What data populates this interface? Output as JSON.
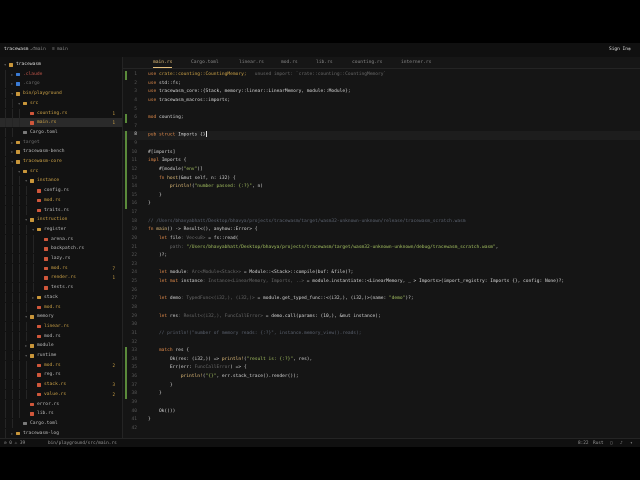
{
  "titlebar": {
    "project": "tracewasm",
    "branch": "main",
    "menu": "main",
    "signin": "Sign In",
    "ellipsis": "..."
  },
  "sidebar": {
    "items": [
      {
        "label": "tracewasm",
        "type": "dir",
        "depth": 0,
        "open": true,
        "color": "#e0e0e0"
      },
      {
        "label": ".claude",
        "type": "dir",
        "depth": 1,
        "open": false,
        "color": "#c4564a"
      },
      {
        "label": ".cargo",
        "type": "dir",
        "depth": 1,
        "open": false,
        "color": "#6e6e6e"
      },
      {
        "label": "bin/playground",
        "type": "dir",
        "depth": 1,
        "open": true,
        "color": "#d0a548"
      },
      {
        "label": "src",
        "type": "dir",
        "depth": 2,
        "open": true,
        "color": "#d0a548"
      },
      {
        "label": "counting.rs",
        "type": "rs",
        "depth": 3,
        "badge": "1",
        "color": "#d0a548"
      },
      {
        "label": "main.rs",
        "type": "rs",
        "depth": 3,
        "badge": "1",
        "color": "#d0a548",
        "selected": true
      },
      {
        "label": "Cargo.toml",
        "type": "toml",
        "depth": 2,
        "color": "#bdbdbd"
      },
      {
        "label": "target",
        "type": "dir",
        "depth": 1,
        "open": false,
        "color": "#6e6e6e"
      },
      {
        "label": "tracewasm-bench",
        "type": "dir",
        "depth": 1,
        "open": false,
        "color": "#bdbdbd"
      },
      {
        "label": "tracewasm-core",
        "type": "dir",
        "depth": 1,
        "open": true,
        "color": "#d0a548"
      },
      {
        "label": "src",
        "type": "dir",
        "depth": 2,
        "open": true,
        "color": "#d0a548"
      },
      {
        "label": "instance",
        "type": "dir",
        "depth": 3,
        "open": true,
        "color": "#d0a548"
      },
      {
        "label": "config.rs",
        "type": "rs",
        "depth": 4,
        "color": "#bdbdbd"
      },
      {
        "label": "mod.rs",
        "type": "rs",
        "depth": 4,
        "color": "#d0a548"
      },
      {
        "label": "traits.rs",
        "type": "rs",
        "depth": 4,
        "color": "#bdbdbd"
      },
      {
        "label": "instruction",
        "type": "dir",
        "depth": 3,
        "open": true,
        "color": "#d0a548"
      },
      {
        "label": "register",
        "type": "dir",
        "depth": 4,
        "open": true,
        "color": "#bdbdbd"
      },
      {
        "label": "arena.rs",
        "type": "rs",
        "depth": 5,
        "color": "#bdbdbd"
      },
      {
        "label": "backpatch.rs",
        "type": "rs",
        "depth": 5,
        "color": "#bdbdbd"
      },
      {
        "label": "lazy.rs",
        "type": "rs",
        "depth": 5,
        "color": "#bdbdbd"
      },
      {
        "label": "mod.rs",
        "type": "rs",
        "depth": 5,
        "badge": "7",
        "color": "#d0a548"
      },
      {
        "label": "render.rs",
        "type": "rs",
        "depth": 5,
        "badge": "1",
        "color": "#d0a548"
      },
      {
        "label": "tests.rs",
        "type": "rs",
        "depth": 5,
        "color": "#bdbdbd"
      },
      {
        "label": "stack",
        "type": "dir",
        "depth": 4,
        "open": false,
        "color": "#bdbdbd"
      },
      {
        "label": "mod.rs",
        "type": "rs",
        "depth": 4,
        "color": "#d0a548"
      },
      {
        "label": "memory",
        "type": "dir",
        "depth": 3,
        "open": true,
        "color": "#bdbdbd"
      },
      {
        "label": "linear.rs",
        "type": "rs",
        "depth": 4,
        "color": "#d0a548"
      },
      {
        "label": "mod.rs",
        "type": "rs",
        "depth": 4,
        "color": "#bdbdbd"
      },
      {
        "label": "module",
        "type": "dir",
        "depth": 3,
        "open": false,
        "color": "#bdbdbd"
      },
      {
        "label": "runtime",
        "type": "dir",
        "depth": 3,
        "open": true,
        "color": "#bdbdbd"
      },
      {
        "label": "mod.rs",
        "type": "rs",
        "depth": 4,
        "badge": "2",
        "color": "#d0a548"
      },
      {
        "label": "reg.rs",
        "type": "rs",
        "depth": 4,
        "color": "#bdbdbd"
      },
      {
        "label": "stack.rs",
        "type": "rs",
        "depth": 4,
        "badge": "3",
        "color": "#d0a548"
      },
      {
        "label": "value.rs",
        "type": "rs",
        "depth": 4,
        "badge": "2",
        "color": "#d0a548"
      },
      {
        "label": "error.rs",
        "type": "rs",
        "depth": 3,
        "color": "#bdbdbd"
      },
      {
        "label": "lib.rs",
        "type": "rs",
        "depth": 3,
        "color": "#bdbdbd"
      },
      {
        "label": "Cargo.toml",
        "type": "toml",
        "depth": 2,
        "color": "#bdbdbd"
      },
      {
        "label": "tracewasm-log",
        "type": "dir",
        "depth": 1,
        "open": false,
        "color": "#bdbdbd"
      }
    ]
  },
  "tabs": [
    {
      "label": "main.rs",
      "active": true
    },
    {
      "label": "Cargo.toml"
    },
    {
      "label": "linear.rs"
    },
    {
      "label": "mod.rs"
    },
    {
      "label": "lib.rs"
    },
    {
      "label": "counting.rs"
    },
    {
      "label": "interner.rs"
    }
  ],
  "editor": {
    "current_line": 8,
    "lines": [
      {
        "g": "add",
        "t": [
          [
            "use ",
            "k"
          ],
          [
            "crate",
            "u"
          ],
          [
            "::counting::CountingMemory;",
            "u"
          ],
          [
            "   unused import: `crate::counting::CountingMemory`",
            "hint"
          ]
        ]
      },
      {
        "t": [
          [
            "use ",
            "k"
          ],
          [
            "std::fs;",
            "t"
          ]
        ]
      },
      {
        "t": [
          [
            "use ",
            "k"
          ],
          [
            "tracewasm_core::{Stack, memory::linear::LinearMemory, module::Module};",
            "t"
          ]
        ]
      },
      {
        "t": [
          [
            "use ",
            "k"
          ],
          [
            "tracewasm_macros::imports;",
            "t"
          ]
        ]
      },
      {
        "t": []
      },
      {
        "g": "add",
        "t": [
          [
            "mod ",
            "k"
          ],
          [
            "counting;",
            "t"
          ]
        ]
      },
      {
        "t": []
      },
      {
        "g": "add",
        "t": [
          [
            "pub struct ",
            "k"
          ],
          [
            "Imports {}",
            "t"
          ],
          [
            "",
            "cursor"
          ]
        ]
      },
      {
        "g": "add",
        "t": []
      },
      {
        "g": "add",
        "t": [
          [
            "#[imports]",
            "t"
          ]
        ]
      },
      {
        "g": "add",
        "t": [
          [
            "impl ",
            "k"
          ],
          [
            "Imports {",
            "t"
          ]
        ]
      },
      {
        "g": "add",
        "t": [
          [
            "    #[module(",
            "t"
          ],
          [
            "\"env\"",
            "s"
          ],
          [
            ")]",
            "t"
          ]
        ]
      },
      {
        "g": "add",
        "t": [
          [
            "    fn ",
            "k"
          ],
          [
            "host",
            "f"
          ],
          [
            "(&mut self, n: i32) {",
            "t"
          ]
        ]
      },
      {
        "g": "add",
        "t": [
          [
            "        println!",
            "f"
          ],
          [
            "(",
            "t"
          ],
          [
            "\"number passed: {:?}\"",
            "s"
          ],
          [
            ", n)",
            "t"
          ]
        ]
      },
      {
        "g": "add",
        "t": [
          [
            "    }",
            "t"
          ]
        ]
      },
      {
        "g": "add",
        "t": [
          [
            "}",
            "t"
          ]
        ]
      },
      {
        "t": []
      },
      {
        "t": [
          [
            "// /Users/bhavyabhatt/Desktop/bhavya/projects/tracewasm/target/wasm32-unknown-unknown/release/tracewasm_scratch.wasm",
            "c"
          ]
        ]
      },
      {
        "t": [
          [
            "fn ",
            "k"
          ],
          [
            "main",
            "f"
          ],
          [
            "() -> Result<(), anyhow::Error> {",
            "t"
          ]
        ]
      },
      {
        "t": [
          [
            "    let ",
            "k"
          ],
          [
            "file",
            "t"
          ],
          [
            ": Vec<u8>",
            "hint"
          ],
          [
            " = fs::read(",
            "t"
          ]
        ]
      },
      {
        "t": [
          [
            "        path: ",
            "hint"
          ],
          [
            "\"/Users/bhavyabhatt/Desktop/bhavya/projects/tracewasm/target/wasm32-unknown-unknown/debug/tracewasm_scratch.wasm\"",
            "s"
          ],
          [
            ",",
            "t"
          ]
        ]
      },
      {
        "t": [
          [
            "    )?;",
            "t"
          ]
        ]
      },
      {
        "t": []
      },
      {
        "t": [
          [
            "    let ",
            "k"
          ],
          [
            "module",
            "t"
          ],
          [
            ": Arc<Module<Stack>>",
            "hint"
          ],
          [
            " = Module::<Stack>::compile(buf: &file)?;",
            "t"
          ]
        ]
      },
      {
        "t": [
          [
            "    let mut ",
            "k"
          ],
          [
            "instance",
            "t"
          ],
          [
            ": Instance<LinearMemory, Imports, ..>",
            "hint"
          ],
          [
            " = module.instantiate::<LinearMemory, _ > Imports>(import_registry: Imports {}, config: None)?;",
            "t"
          ]
        ]
      },
      {
        "t": []
      },
      {
        "t": [
          [
            "    let ",
            "k"
          ],
          [
            "demo",
            "t"
          ],
          [
            ": TypedFunc<(i32,), (i32,)>",
            "hint"
          ],
          [
            " = module.get_typed_func::<(i32,), (i32,)>(name: ",
            "t"
          ],
          [
            "\"demo\"",
            "s"
          ],
          [
            ")?;",
            "t"
          ]
        ]
      },
      {
        "t": []
      },
      {
        "t": [
          [
            "    let ",
            "k"
          ],
          [
            "res",
            "t"
          ],
          [
            ": Result<(i32,), FuncCallError>",
            "hint"
          ],
          [
            " = demo.call(params: (10,), &mut instance);",
            "t"
          ]
        ]
      },
      {
        "t": []
      },
      {
        "t": [
          [
            "    // println!(\"number of memory reads: {:?}\", instance.memory_view().reads);",
            "c"
          ]
        ]
      },
      {
        "t": []
      },
      {
        "g": "add",
        "t": [
          [
            "    match ",
            "k"
          ],
          [
            "res {",
            "t"
          ]
        ]
      },
      {
        "g": "add",
        "t": [
          [
            "        Ok(res: (i32,)) => ",
            "t"
          ],
          [
            "println!",
            "f"
          ],
          [
            "(",
            "t"
          ],
          [
            "\"result is: {:?}\"",
            "s"
          ],
          [
            ", res),",
            "t"
          ]
        ]
      },
      {
        "g": "add",
        "t": [
          [
            "        Err(err: ",
            "t"
          ],
          [
            "FuncCallError",
            "hint"
          ],
          [
            ") => {",
            "t"
          ]
        ]
      },
      {
        "g": "add",
        "t": [
          [
            "            println!",
            "f"
          ],
          [
            "(",
            "t"
          ],
          [
            "\"{}\"",
            "s"
          ],
          [
            ", err.stack_trace().render());",
            "t"
          ]
        ]
      },
      {
        "g": "add",
        "t": [
          [
            "        }",
            "t"
          ]
        ]
      },
      {
        "g": "add",
        "t": [
          [
            "    }",
            "t"
          ]
        ]
      },
      {
        "t": []
      },
      {
        "t": [
          [
            "    Ok(())",
            "t"
          ]
        ]
      },
      {
        "t": [
          [
            "}",
            "t"
          ]
        ]
      },
      {
        "t": []
      }
    ]
  },
  "statusbar": {
    "left_icons": "⊘ 0 ⚠ 39",
    "path": "bin/playground/src/main.rs",
    "position": "8:22",
    "language": "Rust"
  }
}
